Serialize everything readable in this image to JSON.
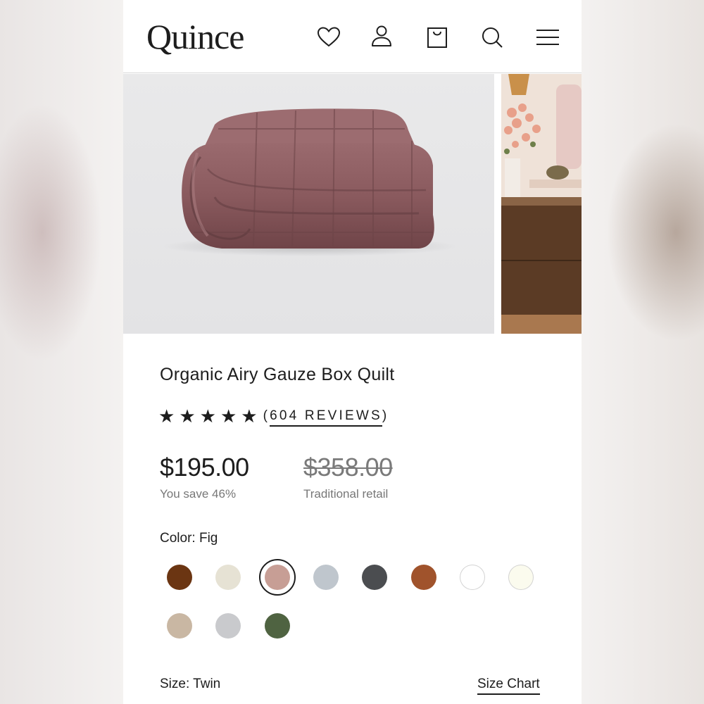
{
  "header": {
    "logo": "Quince",
    "icons": [
      "heart-icon",
      "user-icon",
      "bag-icon",
      "search-icon",
      "menu-icon"
    ]
  },
  "product": {
    "title": "Organic Airy Gauze Box Quilt",
    "rating_stars": 5,
    "reviews_label": "(604 REVIEWS)",
    "reviews_prefix": "(",
    "reviews_text": "604 REVIEWS",
    "reviews_suffix": ")",
    "price": "$195.00",
    "savings": "You save 46%",
    "original_price": "$358.00",
    "original_label": "Traditional retail"
  },
  "color": {
    "label": "Color: Fig",
    "selected_index": 2,
    "swatches": [
      "#6b3512",
      "#e6e2d4",
      "#c79e95",
      "#bfc6cd",
      "#4b4d50",
      "#a0532c",
      "#ffffff",
      "#fbfbee",
      "#c9b7a3",
      "#c9cacd",
      "#4f6341"
    ]
  },
  "size": {
    "label": "Size: Twin",
    "chart_link": "Size Chart"
  },
  "colors": {
    "quilt": "#8a5a5e",
    "text": "#1d1d1d",
    "muted": "#777777"
  }
}
